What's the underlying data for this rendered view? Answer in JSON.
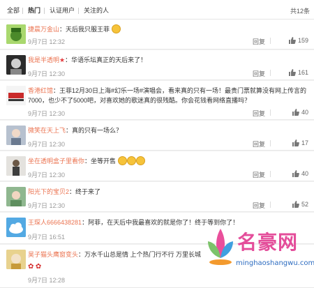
{
  "tabs": [
    {
      "label": "全部"
    },
    {
      "label": "热门"
    },
    {
      "label": "认证用户"
    },
    {
      "label": "关注的人"
    }
  ],
  "total_label": "共12条",
  "action_labels": {
    "reply": "回复"
  },
  "comments": [
    {
      "user": "捷晨万金山",
      "text": "：天后我只服王菲",
      "time": "9月7日 12:32",
      "likes": "159",
      "avatar_color": "#7fbf3f",
      "has_emoji": true
    },
    {
      "user": "我是半透明",
      "text": "：华语乐坛真正的天后来了！",
      "time": "9月7日 12:30",
      "likes": "161",
      "avatar_color": "#3a3a3a",
      "has_star": true
    },
    {
      "user": "香港红馆",
      "text": "：王菲12月30日上海#幻乐一场#演唱会，看来真的只有一场！最贵门票就算没有网上传言的7000，也少不了5000吧，对喜欢她的歌迷真的很残酷。你会花钱看网络直播吗？",
      "time": "9月7日 12:30",
      "likes": "40",
      "avatar_color": "#e0e0e0"
    },
    {
      "user": "微笑在天上飞",
      "text": "：真的只有一场么？",
      "time": "9月7日 12:30",
      "likes": "17",
      "avatar_color": "#9aa4b4"
    },
    {
      "user": "坐在透明盒子里看你",
      "text": "：坐等开售",
      "time": "9月7日 12:30",
      "likes": "40",
      "avatar_color": "#c2c0bc",
      "emoji_count": 3
    },
    {
      "user": "阳光下的宝贝2",
      "text": "：终于来了",
      "time": "9月7日 12:30",
      "likes": "52",
      "avatar_color": "#7aa37a"
    },
    {
      "user": "王琛人6666438281",
      "text": "：阿菲，在天后中我最喜欢的就是你了！终于等到你了！",
      "time": "9月7日 16:51",
      "likes": "",
      "avatar_color": "#4a9fd8"
    },
    {
      "user": "昊子猫头鹰窗变头",
      "text": "：万水千山总是情 上个热门行不行 万里长城",
      "time": "9月7日 12:28",
      "likes": "",
      "avatar_color": "#d8c27a",
      "has_flowers": true
    }
  ],
  "watermark": {
    "brand": "名豪网",
    "url": "minghaoshangwu.com"
  }
}
